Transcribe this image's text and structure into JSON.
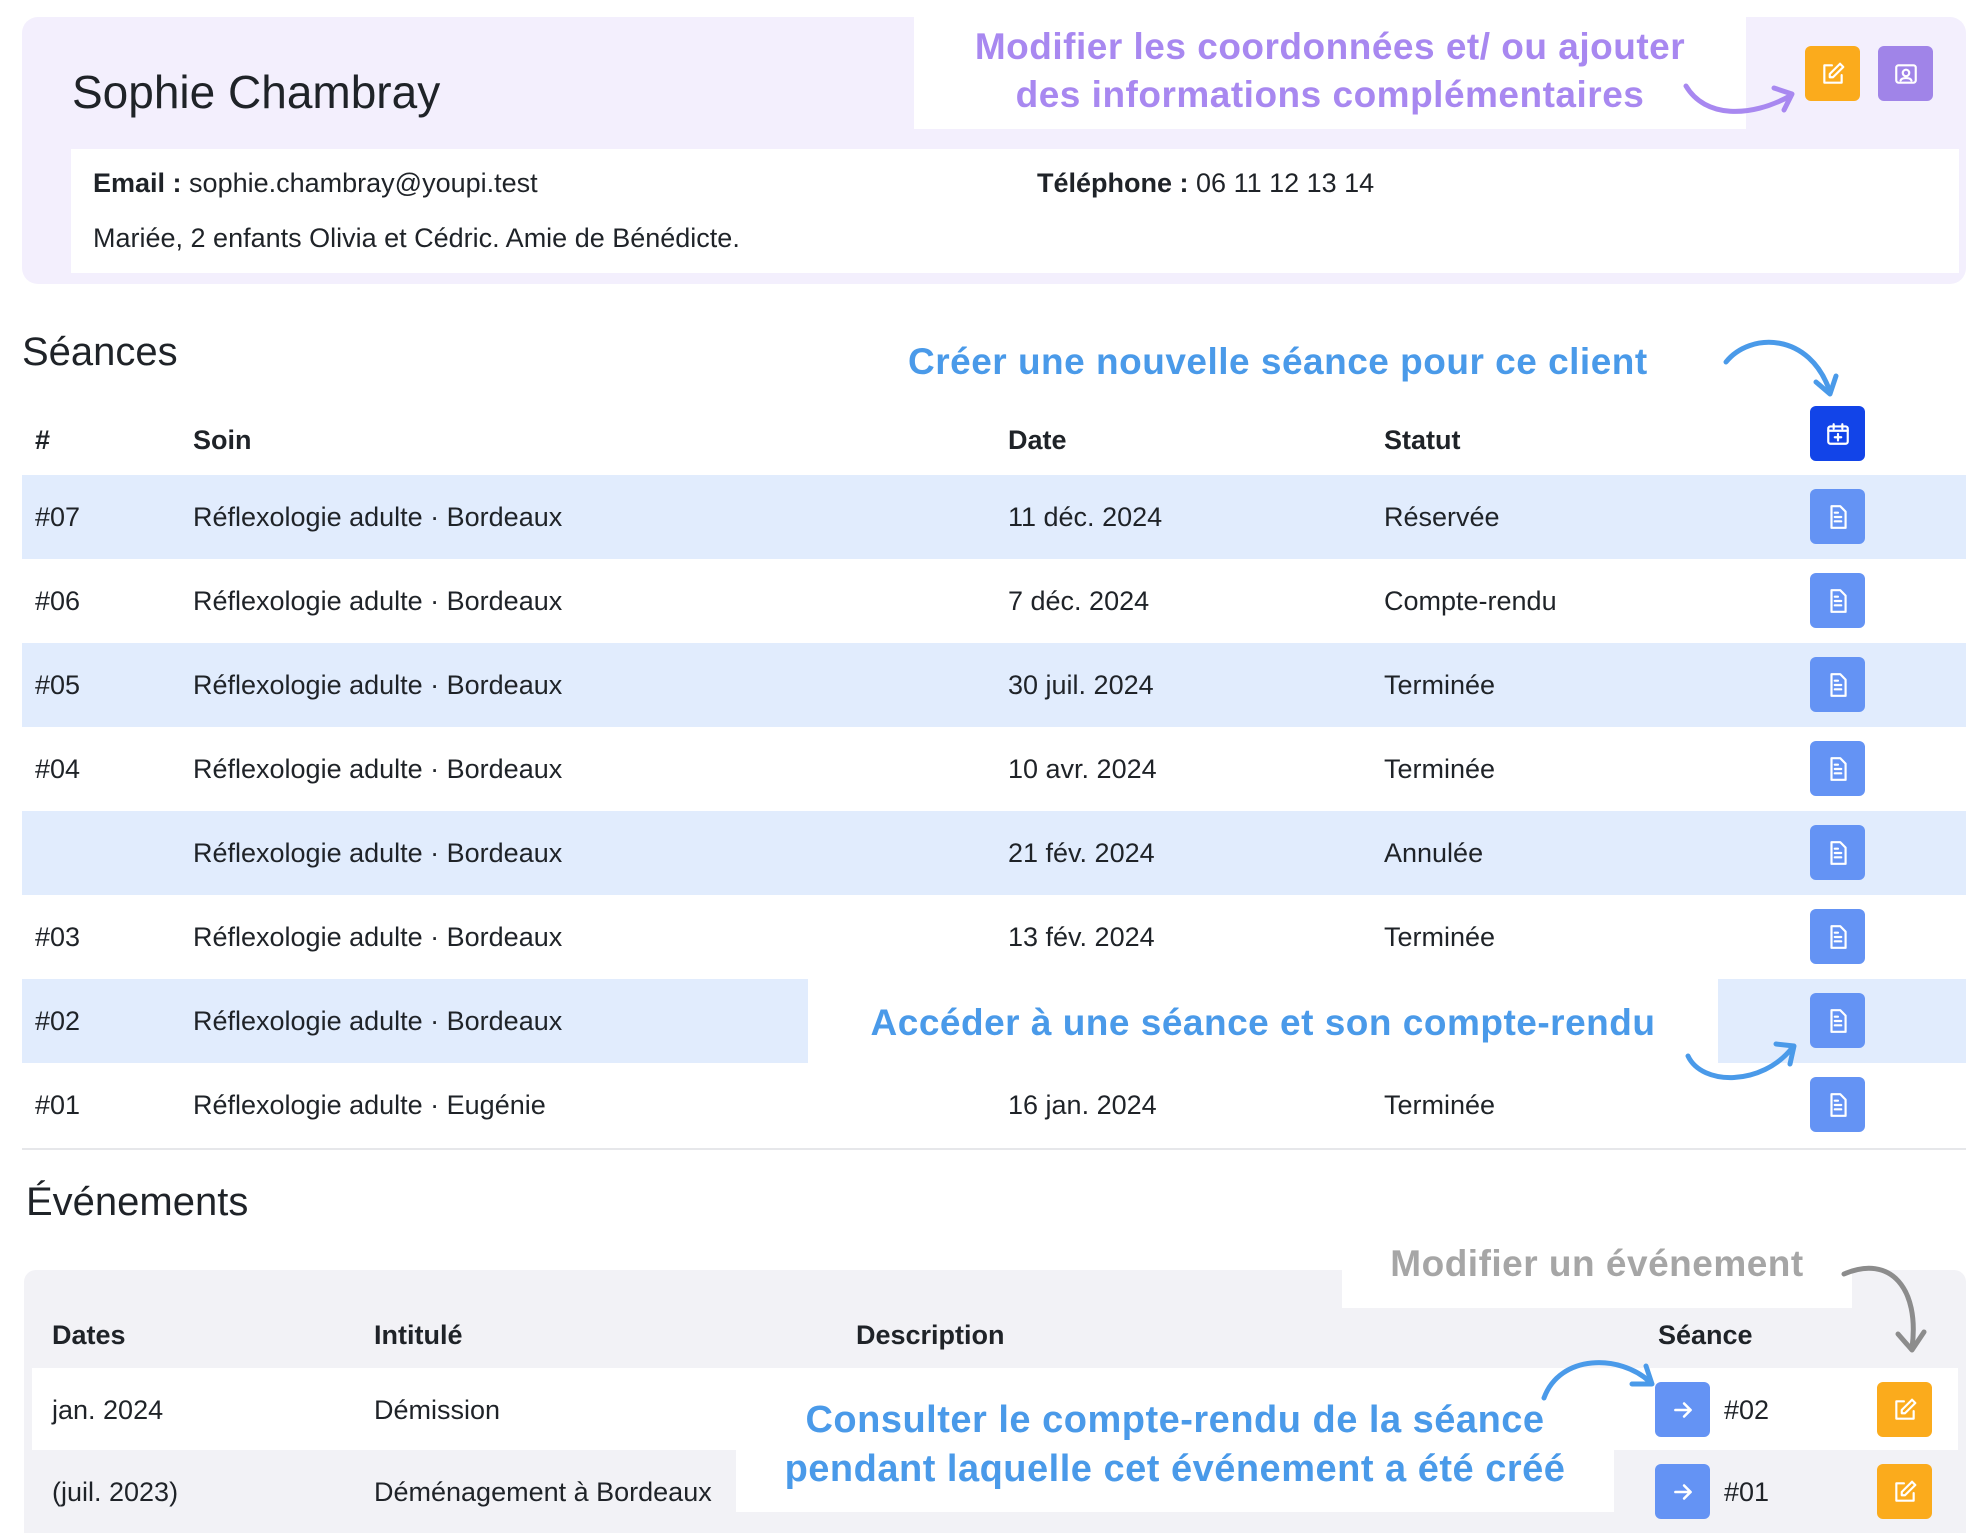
{
  "client": {
    "name": "Sophie Chambray",
    "email_label": "Email :",
    "email": "sophie.chambray@youpi.test",
    "phone_label": "Téléphone :",
    "phone": "06 11 12 13 14",
    "notes": "Mariée, 2 enfants Olivia et Cédric. Amie de Bénédicte."
  },
  "annotations": {
    "edit_client_line1": "Modifier les coordonnées et/ ou ajouter",
    "edit_client_line2": "des informations complémentaires",
    "new_session": "Créer une nouvelle séance pour ce client",
    "open_session": "Accéder à une séance et son compte-rendu",
    "edit_event": "Modifier un événement",
    "view_report_line1": "Consulter le compte-rendu de la séance",
    "view_report_line2": "pendant laquelle cet événement a été créé"
  },
  "sessions": {
    "title": "Séances",
    "headers": {
      "num": "#",
      "soin": "Soin",
      "date": "Date",
      "statut": "Statut"
    },
    "rows": [
      {
        "num": "#07",
        "soin": "Réflexologie adulte · Bordeaux",
        "date": "11 déc. 2024",
        "statut": "Réservée"
      },
      {
        "num": "#06",
        "soin": "Réflexologie adulte · Bordeaux",
        "date": "7 déc. 2024",
        "statut": "Compte-rendu"
      },
      {
        "num": "#05",
        "soin": "Réflexologie adulte · Bordeaux",
        "date": "30 juil. 2024",
        "statut": "Terminée"
      },
      {
        "num": "#04",
        "soin": "Réflexologie adulte · Bordeaux",
        "date": "10 avr. 2024",
        "statut": "Terminée"
      },
      {
        "num": "",
        "soin": "Réflexologie adulte · Bordeaux",
        "date": "21 fév. 2024",
        "statut": "Annulée"
      },
      {
        "num": "#03",
        "soin": "Réflexologie adulte · Bordeaux",
        "date": "13 fév. 2024",
        "statut": "Terminée"
      },
      {
        "num": "#02",
        "soin": "Réflexologie adulte · Bordeaux",
        "date": "",
        "statut": ""
      },
      {
        "num": "#01",
        "soin": "Réflexologie adulte · Eugénie",
        "date": "16 jan. 2024",
        "statut": "Terminée"
      }
    ]
  },
  "events": {
    "title": "Événements",
    "headers": {
      "dates": "Dates",
      "intitule": "Intitulé",
      "description": "Description",
      "seance": "Séance"
    },
    "rows": [
      {
        "dates": "jan. 2024",
        "intitule": "Démission",
        "seance": "#02"
      },
      {
        "dates": "(juil. 2023)",
        "intitule": "Déménagement à Bordeaux",
        "seance": "#01"
      }
    ]
  },
  "colors": {
    "accent_orange": "#fbab1c",
    "accent_purple": "#a084e8",
    "accent_blue": "#6493f4",
    "accent_blue_dark": "#1244e8",
    "row_shade": "#e1ecfd",
    "card_bg": "#f3effd"
  },
  "icons": {
    "edit": "pencil-square-icon",
    "contact_card": "contact-card-icon",
    "new_session": "calendar-plus-icon",
    "document": "document-icon",
    "arrow_right": "arrow-right-icon"
  }
}
